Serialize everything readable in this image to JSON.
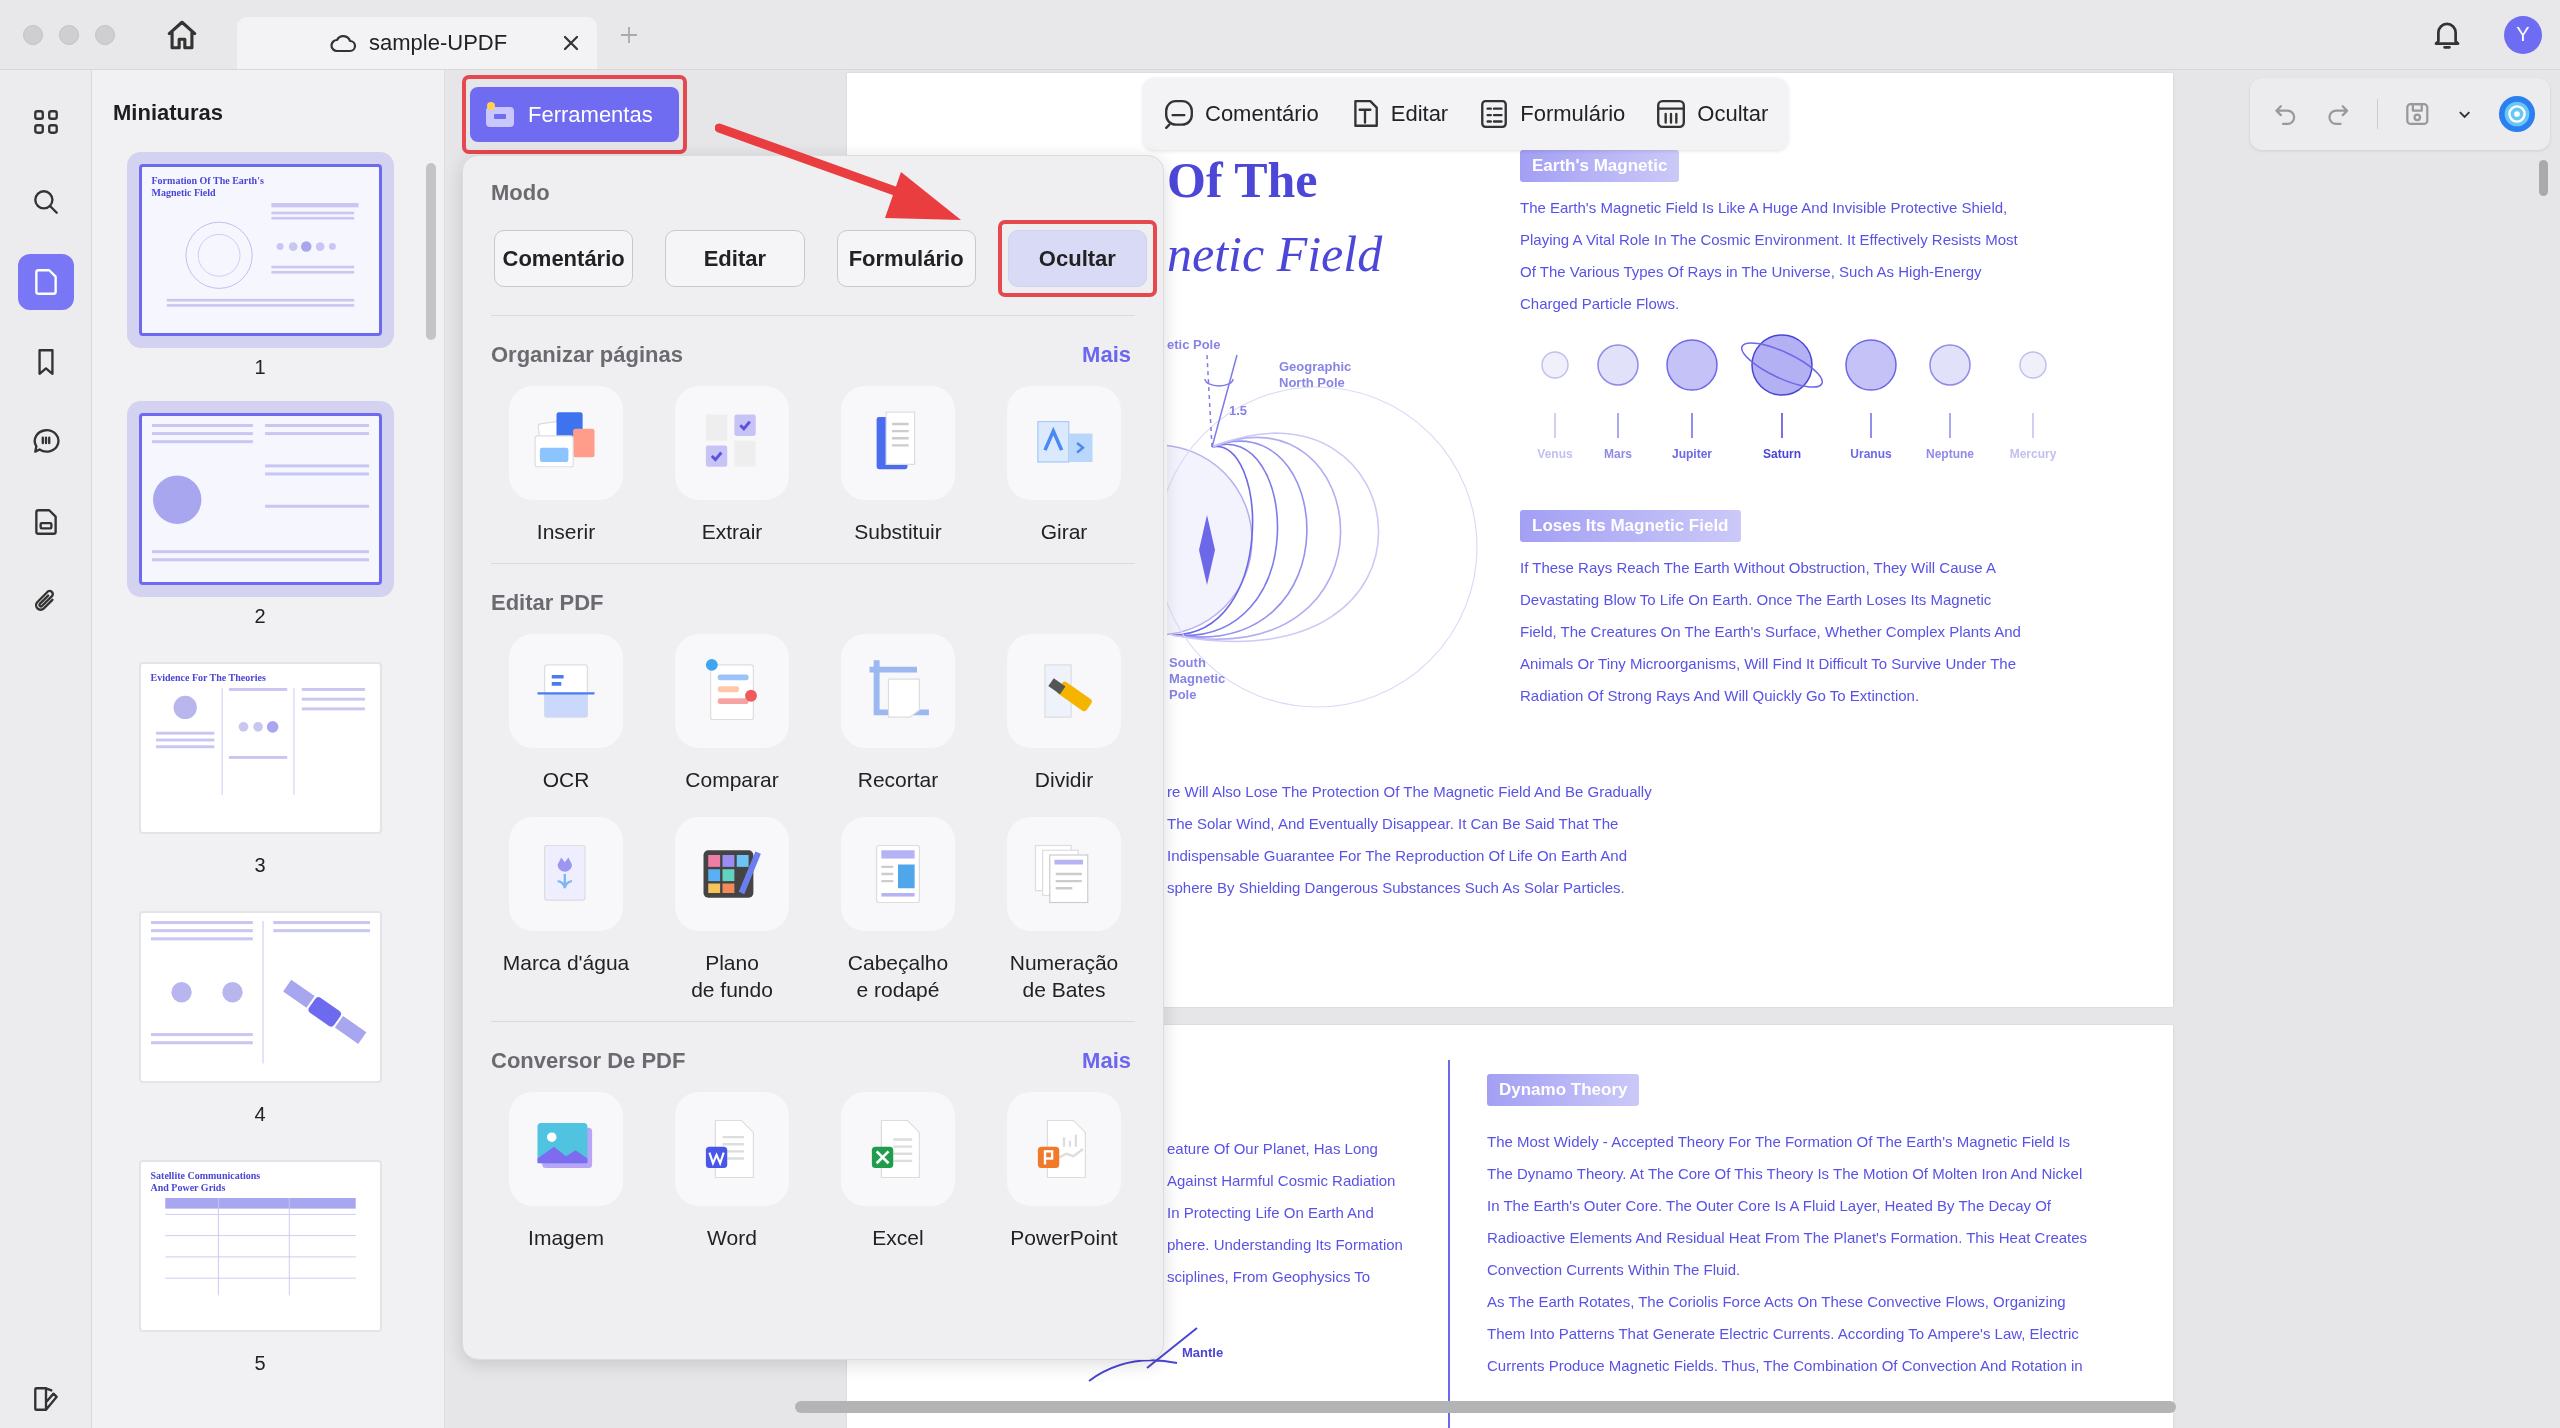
{
  "window": {
    "tab_title": "sample-UPDF",
    "avatar": "Y"
  },
  "rail": [
    {
      "selected": false
    },
    {
      "selected": false
    },
    {
      "selected": true
    },
    {
      "selected": false
    },
    {
      "selected": false
    },
    {
      "selected": false
    },
    {
      "selected": false
    }
  ],
  "thumbnails": {
    "title": "Miniaturas",
    "pages": [
      {
        "number": "1",
        "selected": true,
        "title": "Formation Of The Earth's Magnetic Field"
      },
      {
        "number": "2",
        "selected": true
      },
      {
        "number": "3",
        "selected": false,
        "title": "Evidence For The Theories"
      },
      {
        "number": "4",
        "selected": false
      },
      {
        "number": "5",
        "selected": false,
        "title": "Satellite Communications And Power Grids"
      }
    ]
  },
  "tools_button": {
    "label": "Ferramentas",
    "highlighted": true
  },
  "mode_toolbar": [
    {
      "label": "Comentário"
    },
    {
      "label": "Editar"
    },
    {
      "label": "Formulário"
    },
    {
      "label": "Ocultar"
    }
  ],
  "popup": {
    "mode_title": "Modo",
    "modes": [
      {
        "label": "Comentário",
        "selected": false,
        "highlighted": false
      },
      {
        "label": "Editar",
        "selected": false,
        "highlighted": false
      },
      {
        "label": "Formulário",
        "selected": false,
        "highlighted": false
      },
      {
        "label": "Ocultar",
        "selected": true,
        "highlighted": true
      }
    ],
    "sections": [
      {
        "title": "Organizar páginas",
        "more": "Mais",
        "tools": [
          {
            "label": "Inserir"
          },
          {
            "label": "Extrair"
          },
          {
            "label": "Substituir"
          },
          {
            "label": "Girar"
          }
        ]
      },
      {
        "title": "Editar PDF",
        "tools": [
          {
            "label": "OCR"
          },
          {
            "label": "Comparar"
          },
          {
            "label": "Recortar"
          },
          {
            "label": "Dividir"
          },
          {
            "label": "Marca d'água"
          },
          {
            "label": "Plano\nde fundo"
          },
          {
            "label": "Cabeçalho\ne rodapé"
          },
          {
            "label": "Numeração\nde Bates"
          }
        ]
      },
      {
        "title": "Conversor De PDF",
        "more": "Mais",
        "tools": [
          {
            "label": "Imagem"
          },
          {
            "label": "Word"
          },
          {
            "label": "Excel"
          },
          {
            "label": "PowerPoint"
          }
        ]
      }
    ]
  },
  "annotations": [
    {
      "kind": "arrow"
    }
  ],
  "page_1": {
    "heading": [
      "Of The",
      "netic Field"
    ],
    "diagram_labels": [
      "etic Pole",
      "Geographic\nNorth Pole",
      "1.5",
      "South\nMagnetic\nPole"
    ],
    "sections": [
      {
        "badge": "Earth's Magnetic",
        "lines": [
          "The Earth's Magnetic Field Is Like A Huge And Invisible Protective Shield,",
          "Playing A Vital Role In The Cosmic Environment. It Effectively Resists Most",
          "Of The Various Types Of Rays in The Universe, Such As High-Energy",
          "Charged Particle Flows."
        ]
      },
      {
        "badge": "Loses Its Magnetic Field",
        "lines": [
          "If These Rays Reach The Earth Without Obstruction, They Will Cause A",
          "Devastating Blow To Life On Earth. Once The Earth Loses Its Magnetic",
          "Field, The Creatures On The Earth's Surface, Whether Complex Plants And",
          "Animals Or Tiny Microorganisms, Will Find It Difficult To Survive Under The",
          "Radiation Of Strong Rays And Will Quickly Go To Extinction."
        ]
      }
    ],
    "planets": [
      "Venus",
      "Mars",
      "Jupiter",
      "Saturn",
      "Uranus",
      "Neptune",
      "Mercury"
    ],
    "footer_lines": [
      "re Will Also Lose The Protection Of The Magnetic Field And Be Gradually",
      "The Solar Wind, And Eventually Disappear. It Can Be Said That The",
      "Indispensable Guarantee For The Reproduction Of Life On Earth And",
      "sphere By Shielding Dangerous Substances Such As Solar Particles."
    ]
  },
  "page_2": {
    "left_lines": [
      "eature Of Our Planet, Has Long",
      "Against Harmful Cosmic Radiation",
      "In Protecting Life On Earth And",
      "phere. Understanding Its Formation",
      "sciplines, From Geophysics To"
    ],
    "diagram_label": "Mantle",
    "badge": "Dynamo Theory",
    "paragraphs": [
      [
        "The Most Widely - Accepted Theory For The Formation Of The Earth's Magnetic Field Is",
        "The Dynamo Theory. At The Core Of This Theory Is The Motion Of Molten Iron And Nickel",
        "In The Earth's Outer Core. The Outer Core Is A Fluid Layer, Heated By The Decay Of",
        "Radioactive Elements And Residual Heat From The Planet's Formation. This Heat Creates",
        "Convection Currents Within The Fluid."
      ],
      [
        "As The Earth Rotates, The Coriolis Force Acts On These Convective Flows, Organizing",
        "Them Into Patterns That Generate Electric Currents. According To Ampere's Law, Electric",
        "Currents Produce Magnetic Fields. Thus, The Combination Of Convection And Rotation in"
      ]
    ]
  }
}
